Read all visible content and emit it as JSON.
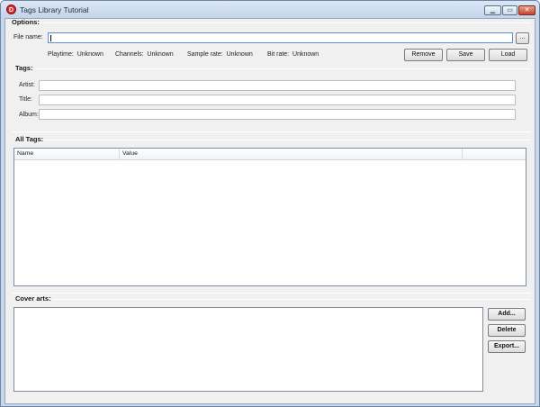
{
  "window": {
    "title": "Tags Library Tutorial",
    "icon_letter": "D",
    "controls": {
      "minimize": "▁",
      "maximize": "▭",
      "close": "✕"
    }
  },
  "options": {
    "section_label": "Options:",
    "file_name_label": "File name:",
    "file_name_value": "",
    "browse_label": "...",
    "info": [
      {
        "label": "Playtime:",
        "value": "Unknown"
      },
      {
        "label": "Channels:",
        "value": "Unknown"
      },
      {
        "label": "Sample rate:",
        "value": "Unknown"
      },
      {
        "label": "Bit rate:",
        "value": "Unknown"
      }
    ],
    "buttons": {
      "remove": "Remove",
      "save": "Save",
      "load": "Load"
    }
  },
  "tags": {
    "section_label": "Tags:",
    "artist_label": "Artist:",
    "artist_value": "",
    "title_label": "Title:",
    "title_value": "",
    "album_label": "Album:",
    "album_value": ""
  },
  "all_tags": {
    "section_label": "All Tags:",
    "columns": [
      "Name",
      "Value",
      ""
    ]
  },
  "cover_arts": {
    "section_label": "Cover arts:",
    "buttons": {
      "add": "Add...",
      "delete": "Delete",
      "export": "Export..."
    }
  }
}
